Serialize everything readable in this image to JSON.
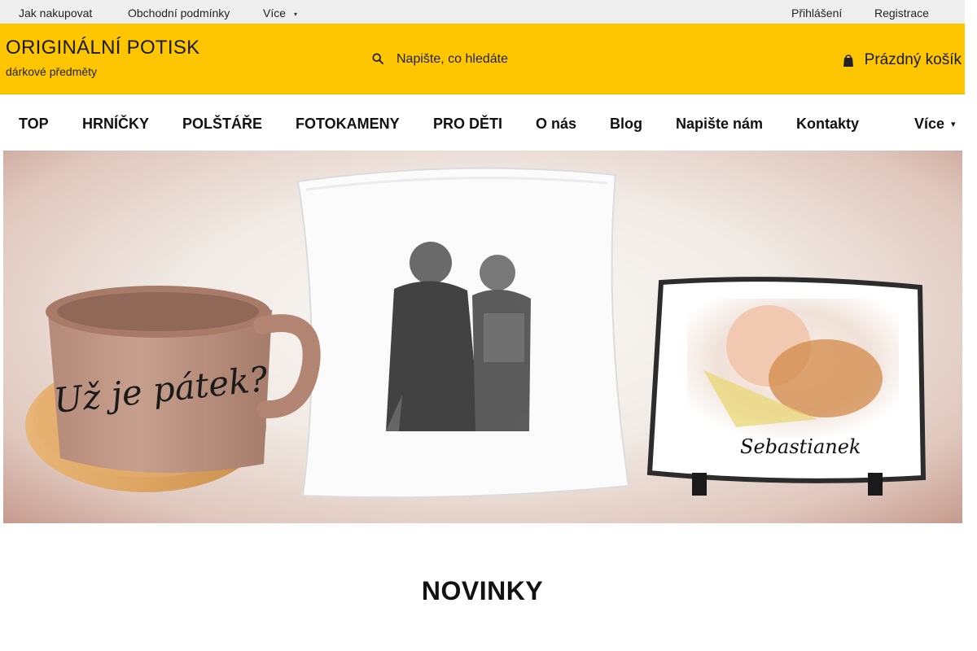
{
  "topbar": {
    "links": [
      "Jak nakupovat",
      "Obchodní podmínky"
    ],
    "more_label": "Více",
    "login_label": "Přihlášení",
    "register_label": "Registrace"
  },
  "header": {
    "brand_title": "ORIGINÁLNÍ POTISK",
    "brand_subtitle": "dárkové předměty",
    "search_placeholder": "Napište, co hledáte",
    "cart_label": "Prázdný košík"
  },
  "nav": {
    "items": [
      "TOP",
      "HRNÍČKY",
      "POLŠTÁŘE",
      "FOTOKAMENY",
      "PRO DĚTI",
      "O nás",
      "Blog",
      "Napište nám",
      "Kontakty"
    ],
    "more_label": "Více"
  },
  "banner": {
    "mug_text": "Už je pátek?",
    "stone_text": "Sebastianek"
  },
  "section": {
    "title": "NOVINKY"
  },
  "colors": {
    "header_bg": "#fec601",
    "topbar_bg": "#efefef"
  },
  "icons": {
    "search": "search-icon",
    "cart": "cart-icon",
    "caret": "chevron-down-icon"
  }
}
